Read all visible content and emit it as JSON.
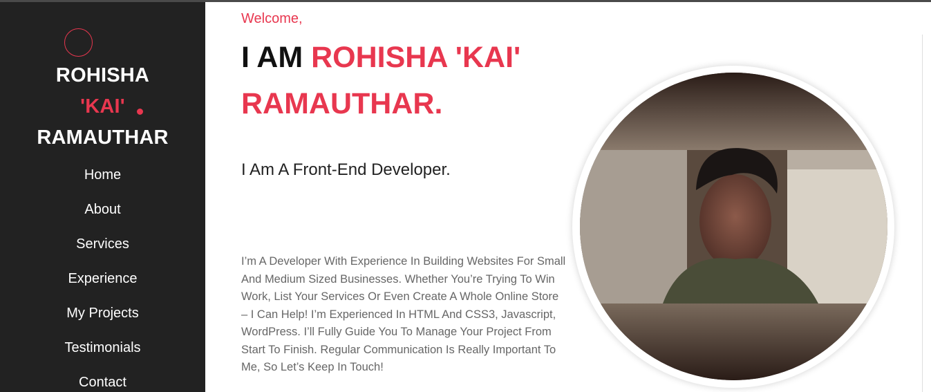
{
  "sidebar": {
    "brand_line1": "ROHISHA",
    "brand_line2": "'KAI'",
    "brand_line3": "RAMAUTHAR",
    "nav": [
      "Home",
      "About",
      "Services",
      "Experience",
      "My Projects",
      "Testimonials",
      "Contact"
    ]
  },
  "hero": {
    "welcome": "Welcome,",
    "headline_prefix": "I AM ",
    "headline_name_line1": "ROHISHA 'KAI'",
    "headline_name_line2": "RAMAUTHAR.",
    "tagline": "I Am A Front-End Developer.",
    "bio": "I’m A Developer With Experience In Building Websites For Small And Medium Sized Businesses. Whether You’re Trying To Win Work, List Your Services Or Even Create A Whole Online Store – I Can Help! I’m Experienced In HTML And CSS3, Javascript, WordPress. I’ll Fully Guide You To Manage Your Project From Start To Finish. Regular Communication Is Really Important To Me, So Let’s Keep In Touch!"
  },
  "colors": {
    "accent": "#e8374f",
    "sidebar_bg": "#222222",
    "text_dark": "#111111",
    "text_muted": "#666666"
  },
  "icons": {
    "logo": "circle-outline-icon",
    "photo": "profile-photo"
  }
}
